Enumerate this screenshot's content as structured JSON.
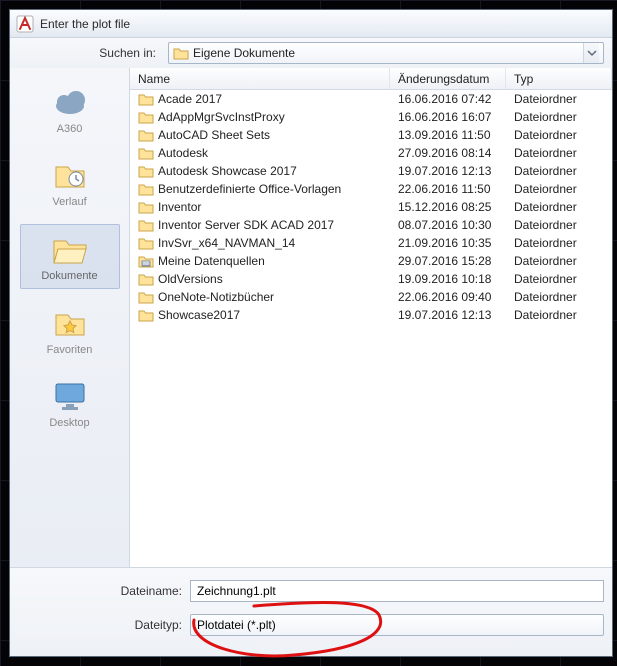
{
  "window": {
    "title": "Enter the plot file"
  },
  "toolbar": {
    "look_in_label": "Suchen in:",
    "look_in_value": "Eigene Dokumente"
  },
  "places": [
    {
      "id": "a360",
      "label": "A360",
      "icon": "cloud"
    },
    {
      "id": "history",
      "label": "Verlauf",
      "icon": "history"
    },
    {
      "id": "documents",
      "label": "Dokumente",
      "icon": "folder-open",
      "selected": true
    },
    {
      "id": "favorites",
      "label": "Favoriten",
      "icon": "folder-star"
    },
    {
      "id": "desktop",
      "label": "Desktop",
      "icon": "monitor"
    }
  ],
  "columns": {
    "name": "Name",
    "date": "Änderungsdatum",
    "type": "Typ"
  },
  "rows": [
    {
      "icon": "folder",
      "name": "Acade 2017",
      "date": "16.06.2016 07:42",
      "type": "Dateiordner"
    },
    {
      "icon": "folder",
      "name": "AdAppMgrSvcInstProxy",
      "date": "16.06.2016 16:07",
      "type": "Dateiordner"
    },
    {
      "icon": "folder",
      "name": "AutoCAD Sheet Sets",
      "date": "13.09.2016 11:50",
      "type": "Dateiordner"
    },
    {
      "icon": "folder",
      "name": "Autodesk",
      "date": "27.09.2016 08:14",
      "type": "Dateiordner"
    },
    {
      "icon": "folder",
      "name": "Autodesk Showcase 2017",
      "date": "19.07.2016 12:13",
      "type": "Dateiordner"
    },
    {
      "icon": "folder",
      "name": "Benutzerdefinierte Office-Vorlagen",
      "date": "22.06.2016 11:50",
      "type": "Dateiordner"
    },
    {
      "icon": "folder",
      "name": "Inventor",
      "date": "15.12.2016 08:25",
      "type": "Dateiordner"
    },
    {
      "icon": "folder",
      "name": "Inventor Server SDK ACAD 2017",
      "date": "08.07.2016 10:30",
      "type": "Dateiordner"
    },
    {
      "icon": "folder",
      "name": "InvSvr_x64_NAVMAN_14",
      "date": "21.09.2016 10:35",
      "type": "Dateiordner"
    },
    {
      "icon": "datasource",
      "name": "Meine Datenquellen",
      "date": "29.07.2016 15:28",
      "type": "Dateiordner"
    },
    {
      "icon": "folder",
      "name": "OldVersions",
      "date": "19.09.2016 10:18",
      "type": "Dateiordner"
    },
    {
      "icon": "folder",
      "name": "OneNote-Notizbücher",
      "date": "22.06.2016 09:40",
      "type": "Dateiordner"
    },
    {
      "icon": "folder",
      "name": "Showcase2017",
      "date": "19.07.2016 12:13",
      "type": "Dateiordner"
    }
  ],
  "form": {
    "filename_label": "Dateiname:",
    "filename_value": "Zeichnung1.plt",
    "filetype_label": "Dateityp:",
    "filetype_value": "Plotdatei (*.plt)"
  }
}
